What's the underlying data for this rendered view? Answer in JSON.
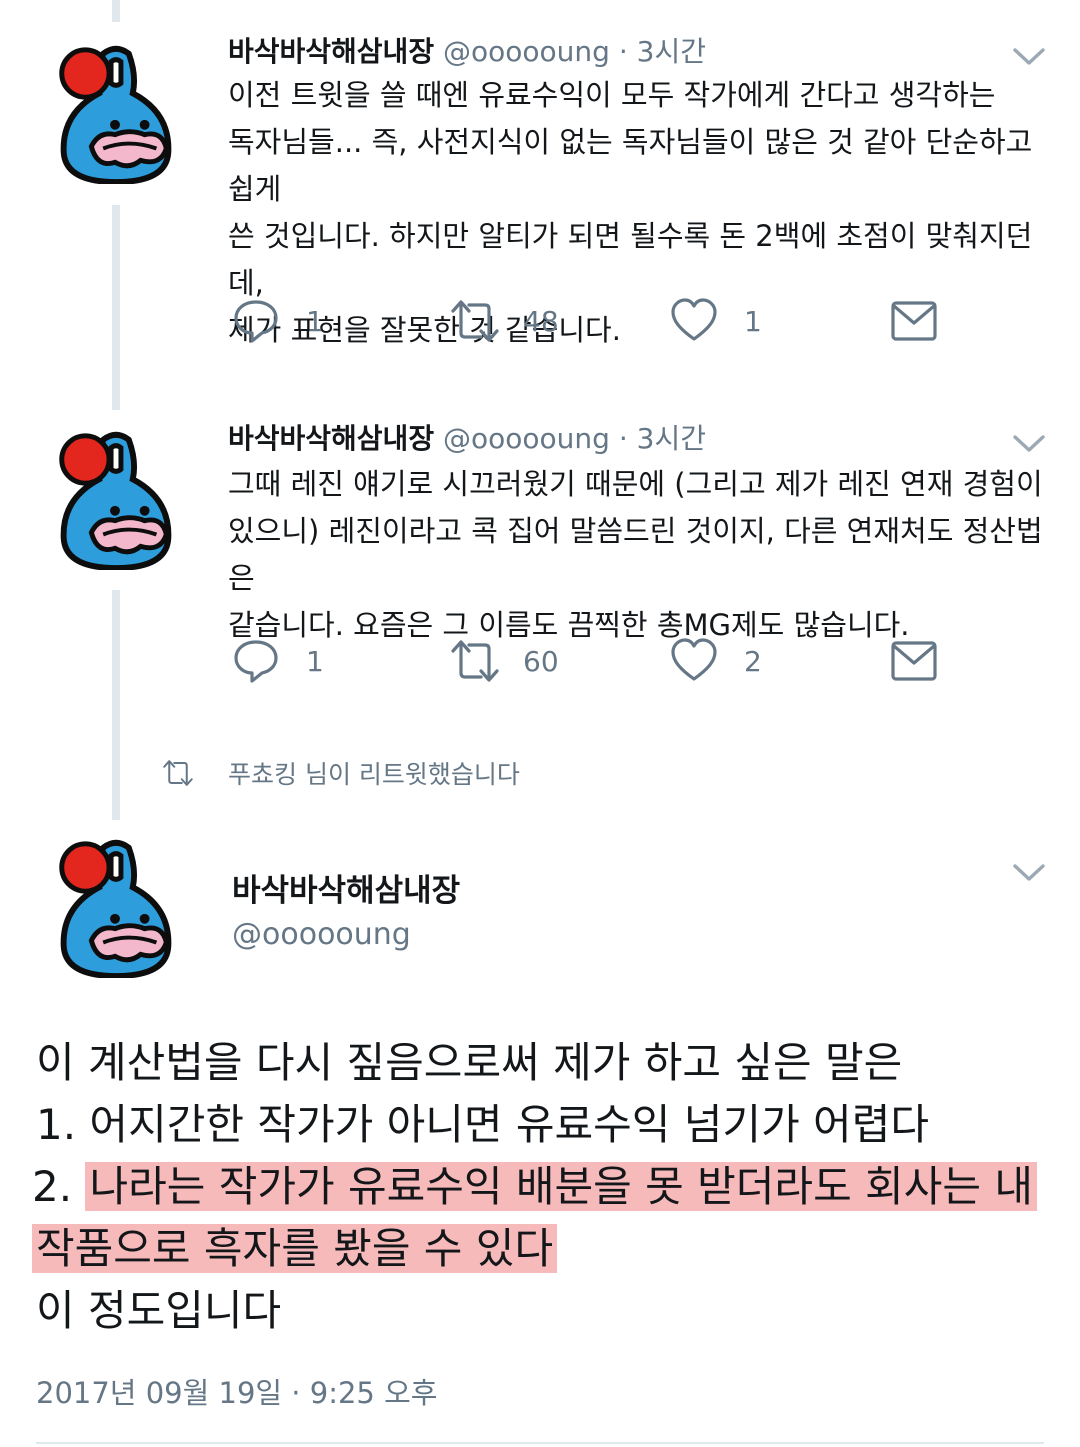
{
  "tweets": [
    {
      "name": "바삭바삭해삼내장",
      "handle": "@oooooung",
      "separator": "·",
      "time": "3시간",
      "lines": [
        "이전 트윗을 쓸 때엔 유료수익이 모두 작가에게 간다고 생각하는",
        "독자님들... 즉, 사전지식이 없는 독자님들이 많은 것 같아 단순하고 쉽게",
        "쓴 것입니다. 하지만 알티가 되면 될수록 돈 2백에 초점이 맞춰지던데,",
        "제가 표현을 잘못한 것 같습니다."
      ],
      "reply_count": "1",
      "retweet_count": "48",
      "like_count": "1"
    },
    {
      "name": "바삭바삭해삼내장",
      "handle": "@oooooung",
      "separator": "·",
      "time": "3시간",
      "lines": [
        "그때 레진 얘기로 시끄러웠기 때문에 (그리고 제가 레진 연재 경험이",
        "있으니) 레진이라고 콕 집어 말씀드린 것이지, 다른 연재처도 정산법은",
        "같습니다. 요즘은 그 이름도 끔찍한 총MG제도 많습니다."
      ],
      "reply_count": "1",
      "retweet_count": "60",
      "like_count": "2"
    }
  ],
  "retweet_notice": "푸쵸킹 님이 리트윗했습니다",
  "main_tweet": {
    "name": "바삭바삭해삼내장",
    "handle": "@oooooung",
    "line1": "이 계산법을 다시 짚음으로써 제가 하고 싶은 말은",
    "line2": "1. 어지간한 작가가 아니면 유료수익 넘기가 어렵다",
    "line3_prefix": "2. ",
    "line3_highlight": "나라는 작가가 유료수익 배분을 못 받더라도 회사는 내",
    "line4_highlight": "작품으로 흑자를 봤을 수 있다",
    "line5": "이 정도입니다",
    "timestamp": "2017년 09월 19일 · 9:25 오후"
  },
  "icons": {
    "reply": "speech-bubble-icon",
    "retweet": "retweet-arrows-icon",
    "like": "heart-icon",
    "dm": "envelope-icon",
    "menu": "chevron-down-icon"
  },
  "colors": {
    "text": "#14171a",
    "secondary": "#657786",
    "thread_line": "#e1e8ed",
    "highlight": "#f4a3a3",
    "avatar_blue": "#2e9ddb",
    "avatar_red": "#e3261e",
    "avatar_pink": "#f4b8cc"
  }
}
